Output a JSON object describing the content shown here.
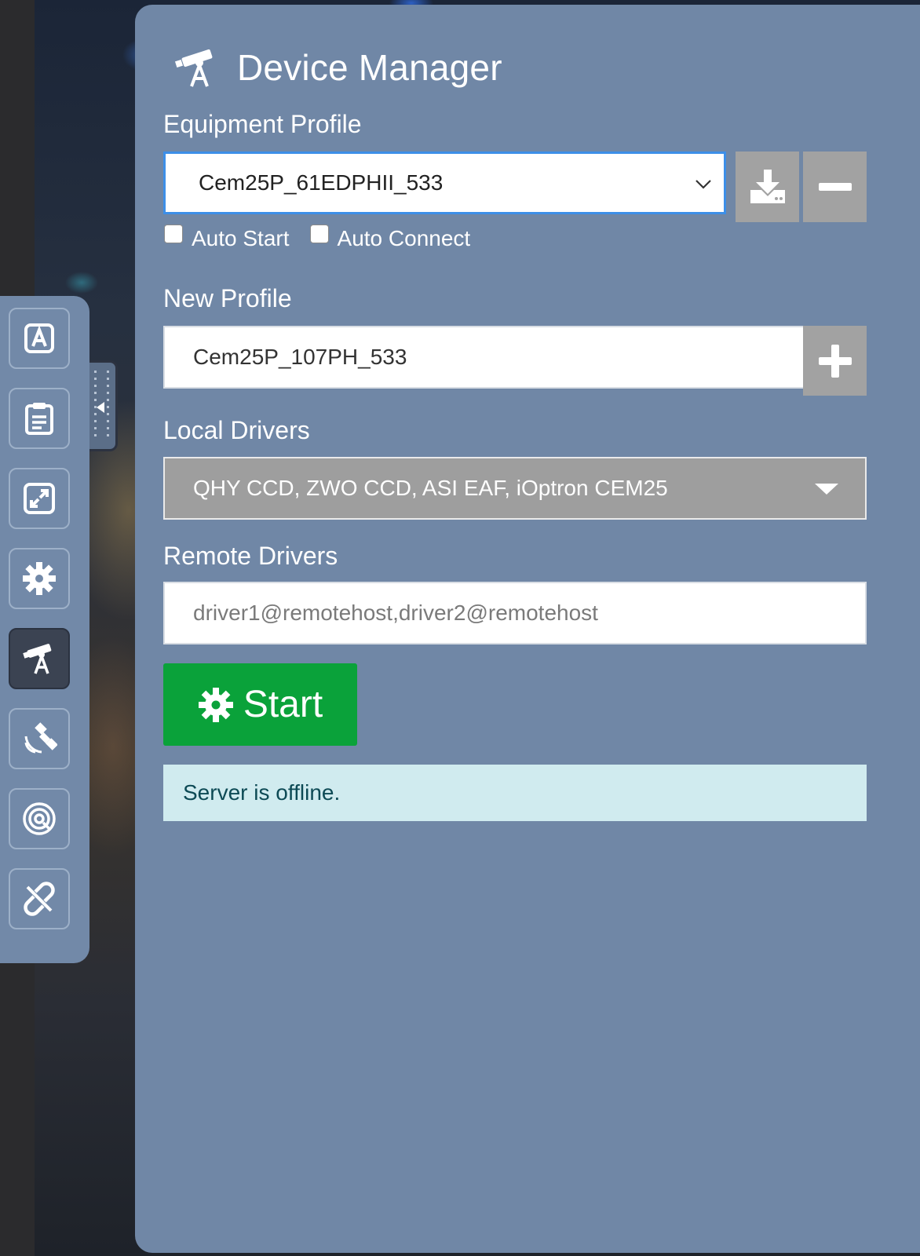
{
  "header": {
    "title": "Device Manager",
    "icon": "telescope-icon"
  },
  "equipment_profile": {
    "label": "Equipment Profile",
    "selected": "Cem25P_61EDPHII_533",
    "auto_start_label": "Auto Start",
    "auto_start_checked": false,
    "auto_connect_label": "Auto Connect",
    "auto_connect_checked": false
  },
  "new_profile": {
    "label": "New Profile",
    "value": "Cem25P_107PH_533"
  },
  "local_drivers": {
    "label": "Local Drivers",
    "selected": "QHY CCD, ZWO CCD, ASI EAF, iOptron CEM25"
  },
  "remote_drivers": {
    "label": "Remote Drivers",
    "placeholder": "driver1@remotehost,driver2@remotehost"
  },
  "start_button": {
    "label": "Start",
    "icon": "gear-icon",
    "color": "#0aa23a"
  },
  "status": {
    "message": "Server is offline."
  },
  "toolbar": {
    "items": [
      {
        "name": "ekos-icon"
      },
      {
        "name": "clipboard-icon"
      },
      {
        "name": "fullscreen-icon"
      },
      {
        "name": "settings-gear-icon"
      },
      {
        "name": "telescope-icon",
        "active": true
      },
      {
        "name": "satellite-icon"
      },
      {
        "name": "target-rings-icon"
      },
      {
        "name": "disconnect-link-icon"
      }
    ]
  },
  "colors": {
    "panel": "#7087a6",
    "accent_border": "#3d8fe8",
    "status_bg": "#d0ebef"
  }
}
